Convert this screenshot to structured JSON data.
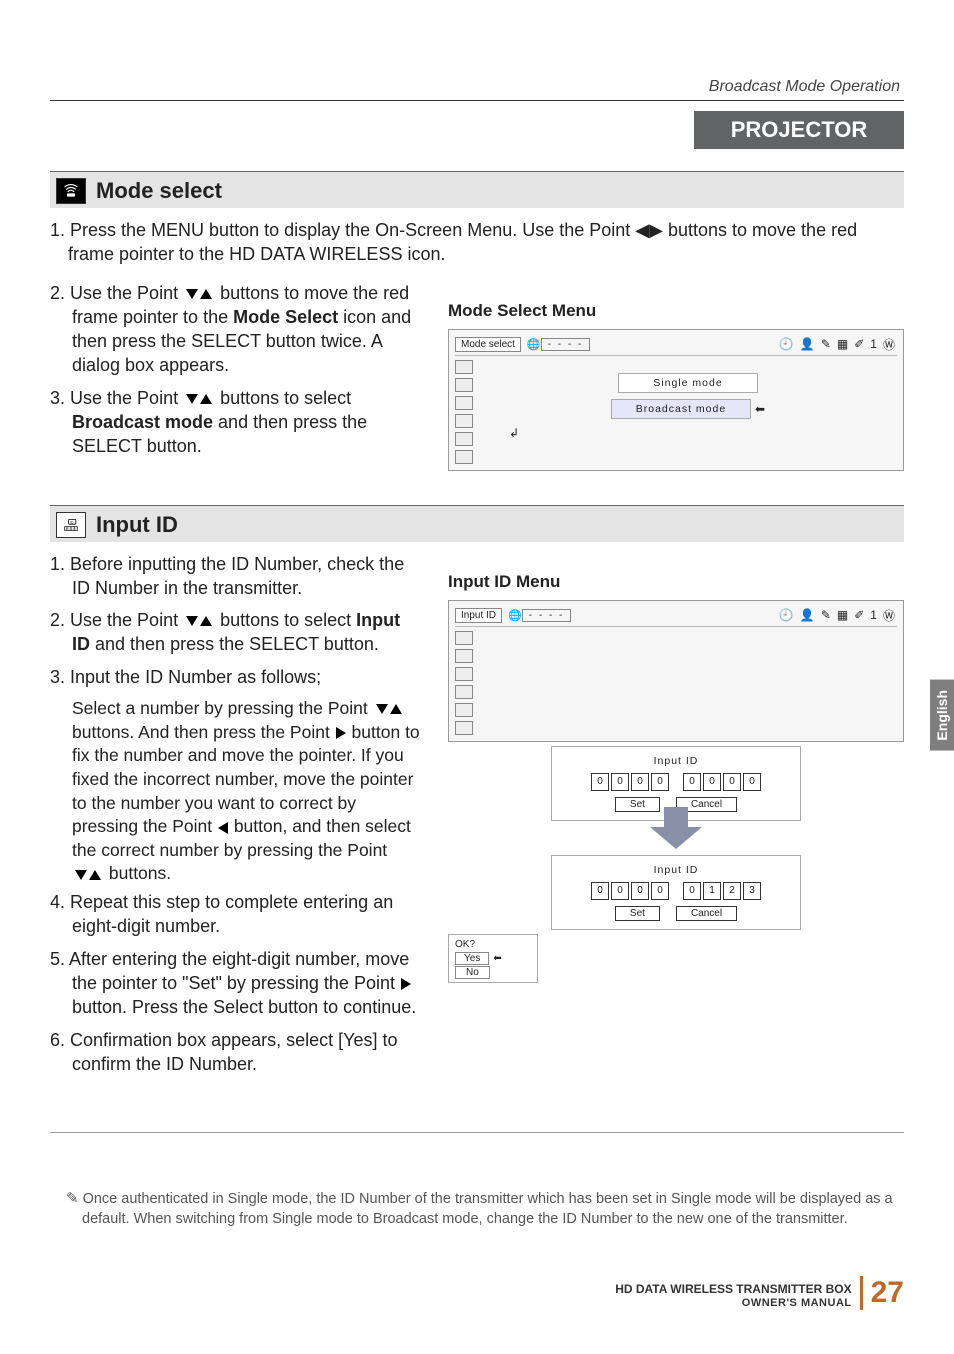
{
  "header": {
    "section": "Broadcast Mode Operation"
  },
  "projector_label": "PROJECTOR",
  "mode_select": {
    "title": "Mode select",
    "step1": "1.  Press the MENU button to display the On-Screen Menu. Use the Point ◀▶ buttons to move the red frame pointer to the HD DATA WIRELESS icon.",
    "step2_a": "2. Use the Point ",
    "step2_b": " buttons to move the red frame pointer to the ",
    "step2_bold": "Mode Select",
    "step2_c": " icon and then press the SELECT button twice. A dialog box appears.",
    "step3_a": "3.  Use the Point ",
    "step3_b": " buttons to select ",
    "step3_bold": "Broadcast mode",
    "step3_c": " and then press the SELECT button.",
    "menu_title": "Mode Select Menu",
    "menu_header_label": "Mode select",
    "menu_dashes": "- - - -",
    "option_single": "Single mode",
    "option_broadcast": "Broadcast mode"
  },
  "input_id": {
    "title": "Input ID",
    "step1": "1. Before inputting the ID Number, check the ID Number in the transmitter.",
    "step2_a": "2. Use the Point ",
    "step2_b": " buttons to select ",
    "step2_bold": "Input ID",
    "step2_c": " and then press the SELECT button.",
    "step3": "3. Input the ID Number as follows;",
    "step3_sub_a": "Select a number by pressing the Point ",
    "step3_sub_b": " buttons. And then press the Point ",
    "step3_sub_c": " button to fix the number and move the pointer. If you fixed the incorrect number, move the pointer to the number you want to correct by pressing the Point ",
    "step3_sub_d": " button, and then select the correct number by pressing the Point ",
    "step3_sub_e": " buttons.",
    "step4": "4. Repeat this step to complete entering an eight-digit number.",
    "step5_a": "5. After entering the eight-digit number, move the pointer to \"Set\" by pressing the Point ",
    "step5_b": " button. Press the Select button to continue.",
    "step6": "6. Confirmation box appears, select [Yes] to confirm the ID Number.",
    "menu_title": "Input ID Menu",
    "menu_header_label": "Input ID",
    "panel_title": "Input ID",
    "digits_initial": [
      "0",
      "0",
      "0",
      "0",
      "0",
      "0",
      "0",
      "0"
    ],
    "digits_entered": [
      "0",
      "0",
      "0",
      "0",
      "0",
      "1",
      "2",
      "3"
    ],
    "btn_set": "Set",
    "btn_cancel": "Cancel",
    "confirm": {
      "title": "OK?",
      "yes": "Yes",
      "no": "No"
    }
  },
  "side_tab": "English",
  "note": "Once authenticated in Single mode, the ID Number of the transmitter which has been set in Single mode will be displayed as a default. When switching from Single mode to Broadcast mode, change the ID Number to the new one of the transmitter.",
  "footer": {
    "line1": "HD DATA WIRELESS TRANSMITTER BOX",
    "line2": "OWNER'S MANUAL",
    "page": "27"
  },
  "tail_num": "1"
}
